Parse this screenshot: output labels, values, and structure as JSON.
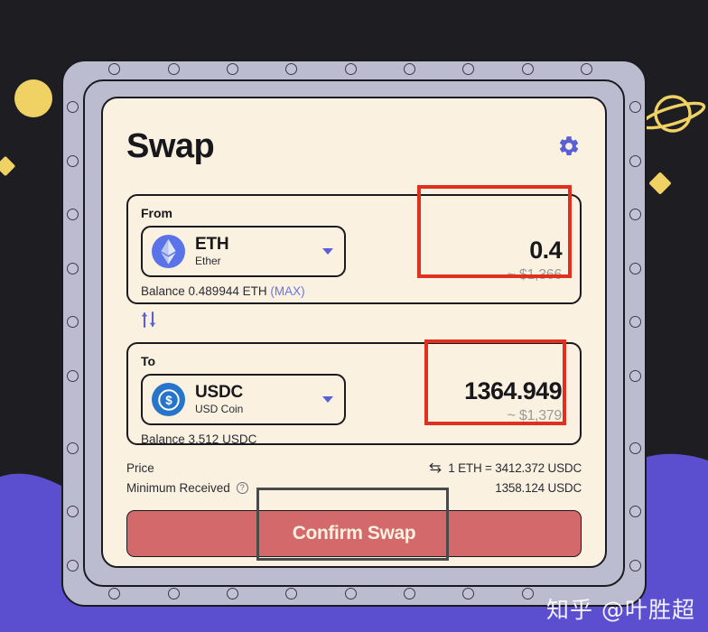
{
  "app": {
    "title": "Swap",
    "settings_icon": "gear-icon"
  },
  "from": {
    "label": "From",
    "token_symbol": "ETH",
    "token_name": "Ether",
    "token_icon": "ethereum-icon",
    "caret_icon": "chevron-down-icon",
    "balance_text": "Balance 0.489944 ETH",
    "max_label": "(MAX)",
    "amount": "0.4",
    "amount_usd": "~ $1,366"
  },
  "switch": {
    "icon": "swap-vertical-arrows-icon"
  },
  "to": {
    "label": "To",
    "token_symbol": "USDC",
    "token_name": "USD Coin",
    "token_icon": "usdc-icon",
    "caret_icon": "chevron-down-icon",
    "balance_text": "Balance 3.512 USDC",
    "amount": "1364.949",
    "amount_usd": "~ $1,379"
  },
  "info": {
    "price_label": "Price",
    "price_icon": "exchange-arrows-icon",
    "price_value": "1 ETH = 3412.372 USDC",
    "minimum_label": "Minimum Received",
    "minimum_help_icon": "question-mark-icon",
    "minimum_help_glyph": "?",
    "minimum_value": "1358.124 USDC"
  },
  "action": {
    "confirm_label": "Confirm Swap"
  },
  "watermark": {
    "text": "知乎 @叶胜超"
  },
  "decorations": {
    "planet_icon": "saturn-planet-icon",
    "circle_icon": "yellow-circle-icon",
    "diamond_left_icon": "yellow-diamond-icon",
    "diamond_right_icon": "yellow-diamond-icon"
  },
  "colors": {
    "background": "#1e1e22",
    "wave": "#5b4fd0",
    "frame": "#bcbcd0",
    "card": "#faf1e1",
    "accent_blue": "#5a5fd6",
    "accent_yellow": "#f0d264",
    "highlight_red": "#e03020",
    "button_red": "#d4696b"
  }
}
